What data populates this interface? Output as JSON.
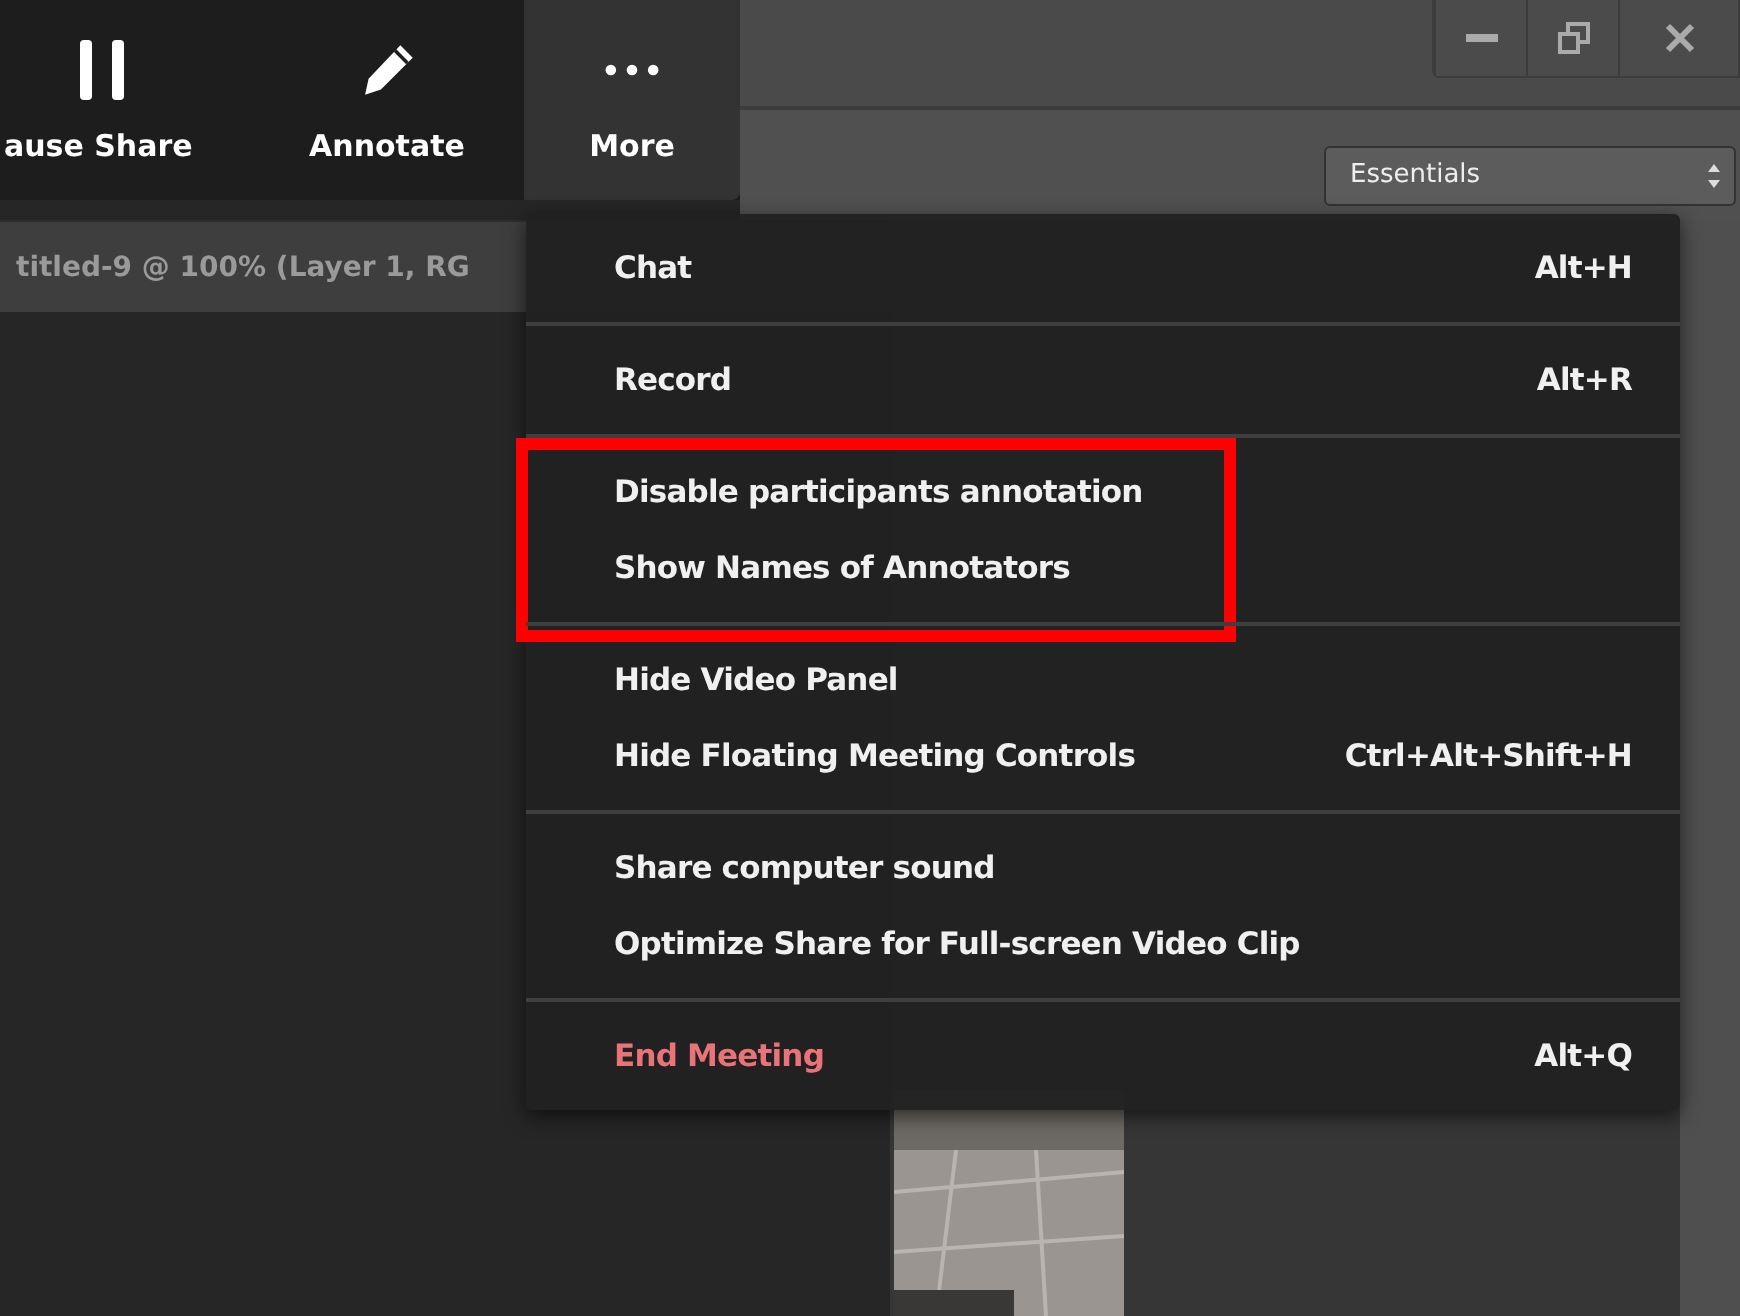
{
  "toolbar": [
    {
      "kind": "pause",
      "label": "ause Share",
      "selected": false
    },
    {
      "kind": "pencil",
      "label": "Annotate",
      "selected": false
    },
    {
      "kind": "dots",
      "label": "More",
      "selected": true
    }
  ],
  "workspace_dropdown": {
    "value": "Essentials"
  },
  "document_tab": {
    "title": "titled-9 @ 100% (Layer 1, RG"
  },
  "menu": {
    "groups": [
      {
        "highlighted": false,
        "items": [
          {
            "label": "Chat",
            "shortcut": "Alt+H",
            "kind": "normal"
          }
        ]
      },
      {
        "highlighted": false,
        "items": [
          {
            "label": "Record",
            "shortcut": "Alt+R",
            "kind": "normal"
          }
        ]
      },
      {
        "highlighted": true,
        "items": [
          {
            "label": "Disable participants annotation",
            "kind": "normal"
          },
          {
            "label": "Show Names of Annotators",
            "kind": "normal"
          }
        ]
      },
      {
        "highlighted": false,
        "items": [
          {
            "label": "Hide Video Panel",
            "kind": "normal"
          },
          {
            "label": "Hide Floating Meeting Controls",
            "shortcut": "Ctrl+Alt+Shift+H",
            "kind": "normal"
          }
        ]
      },
      {
        "highlighted": false,
        "items": [
          {
            "label": "Share computer sound",
            "kind": "normal"
          },
          {
            "label": "Optimize Share for Full-screen Video Clip",
            "kind": "normal"
          }
        ]
      },
      {
        "highlighted": false,
        "items": [
          {
            "label": "End Meeting",
            "shortcut": "Alt+Q",
            "kind": "danger"
          }
        ]
      }
    ]
  }
}
